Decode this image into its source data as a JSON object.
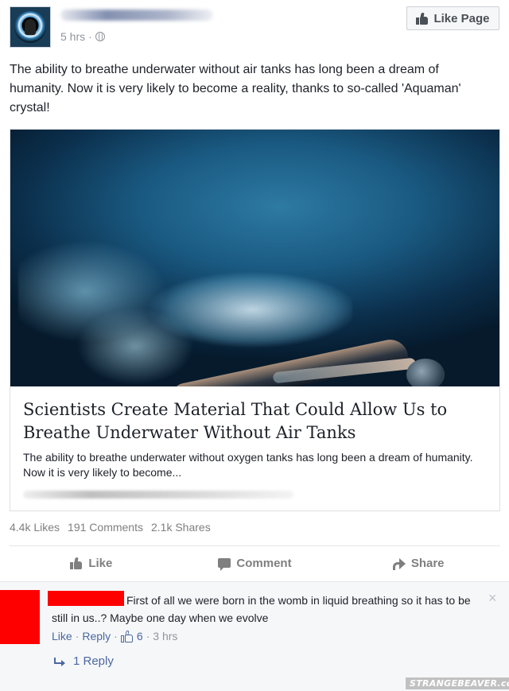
{
  "post": {
    "timestamp": "5 hrs",
    "timestamp_separator": "·",
    "like_page_label": "Like Page",
    "text": "The ability to breathe underwater without air tanks has long been a dream of humanity. Now it is very likely to become a reality, thanks to so-called 'Aquaman' crystal!"
  },
  "link_preview": {
    "title": "Scientists Create Material That Could Allow Us to Breathe Underwater Without Air Tanks",
    "description": "The ability to breathe underwater without oxygen tanks has long been a dream of humanity. Now it is very likely to become..."
  },
  "stats": {
    "likes": "4.4k Likes",
    "comments": "191 Comments",
    "shares": "2.1k Shares"
  },
  "actions": {
    "like": "Like",
    "comment": "Comment",
    "share": "Share"
  },
  "comment": {
    "text": "First of all we were born in the womb in liquid breathing so it has to be still in us..? Maybe one day when we evolve",
    "close": "×",
    "like_label": "Like",
    "separator": "·",
    "reply_label": "Reply",
    "like_count": "6",
    "time": "3 hrs",
    "replies_label": "1 Reply"
  },
  "watermark": "STRANGEBEAVER.com",
  "colors": {
    "link_blue": "#4b67a1",
    "meta_gray": "#90949c",
    "redaction_red": "#ff0000"
  },
  "icons": [
    "globe-icon",
    "thumb-icon",
    "comment-icon",
    "share-icon",
    "close-icon",
    "reply-arrow-icon"
  ]
}
